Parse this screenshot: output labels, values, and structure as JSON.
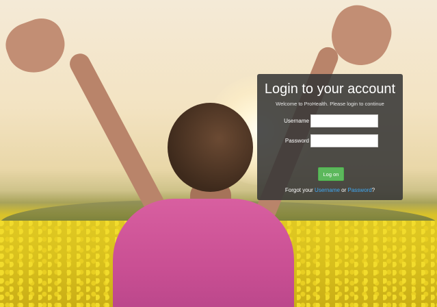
{
  "login": {
    "title": "Login to your account",
    "welcome": "Welcome to ProHealth. Please login to continue",
    "username_label": "Username",
    "password_label": "Password",
    "username_value": "",
    "password_value": "",
    "logon_label": "Log on",
    "forgot_prefix": "Forgot your ",
    "forgot_username_link": "Username",
    "forgot_or": " or ",
    "forgot_password_link": "Password",
    "forgot_suffix": "?"
  },
  "colors": {
    "panel_bg": "#373737",
    "button_green": "#5cb85c",
    "link_blue": "#3fa9f5",
    "shirt_pink": "#d85fa0",
    "field_yellow": "#e0c923"
  }
}
